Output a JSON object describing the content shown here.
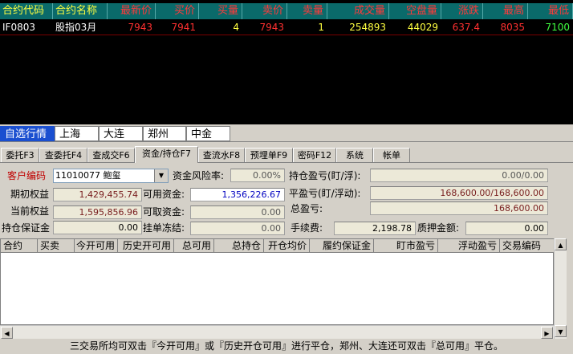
{
  "quote": {
    "headers": [
      "合约代码",
      "合约名称",
      "最新价",
      "买价",
      "买量",
      "卖价",
      "卖量",
      "成交量",
      "空盘量",
      "涨跌",
      "最高",
      "最低"
    ],
    "row": [
      "IF0803",
      "股指03月",
      "7943",
      "7941",
      "4",
      "7943",
      "1",
      "254893",
      "44029",
      "637.4",
      "8035",
      "7100"
    ]
  },
  "market_tabs": [
    "自选行情",
    "上海",
    "大连",
    "郑州",
    "中金"
  ],
  "function_tabs": [
    "委托F3",
    "查委托F4",
    "查成交F6",
    "资金/持仓F7",
    "查流水F8",
    "预埋单F9",
    "密码F12",
    "系统",
    "帐单"
  ],
  "account": {
    "code_label": "客户编码",
    "code_value": "11010077 鲍玺",
    "risk_label": "资金风险率:",
    "risk_value": "0.00%",
    "pos_pl_label": "持仓盈亏(盯/浮):",
    "pos_pl_value": "0.00/0.00",
    "init_equity_label": "期初权益",
    "init_equity_value": "1,429,455.74",
    "avail_label": "可用资金:",
    "avail_value": "1,356,226.67",
    "close_pl_label": "平盈亏(盯/浮动):",
    "close_pl_value": "168,600.00/168,600.00",
    "cur_equity_label": "当前权益",
    "cur_equity_value": "1,595,856.96",
    "withdraw_label": "可取资金:",
    "withdraw_value": "0.00",
    "total_pl_label": "总盈亏:",
    "total_pl_value": "168,600.00",
    "margin_label": "持仓保证金",
    "margin_value": "0.00",
    "frozen_label": "挂单冻结:",
    "frozen_value": "0.00",
    "fee_label": "手续费:",
    "fee_value": "2,198.78",
    "pledge_label": "质押金额:",
    "pledge_value": "0.00"
  },
  "grid": {
    "headers": [
      "合约",
      "买卖",
      "今开可用",
      "历史开可用",
      "总可用",
      "总持仓",
      "开仓均价",
      "履约保证金",
      "盯市盈亏",
      "浮动盈亏",
      "交易编码"
    ]
  },
  "status_text": "三交易所均可双击『今开可用』或『历史开仓可用』进行平仓，郑州、大连还可双击『总可用』平仓。",
  "colors": {
    "quote_header_bg": "#0a6a6a",
    "selected_tab": "#1a4fd0",
    "price_red": "#ff3030",
    "code_yellow": "#ffff40"
  }
}
